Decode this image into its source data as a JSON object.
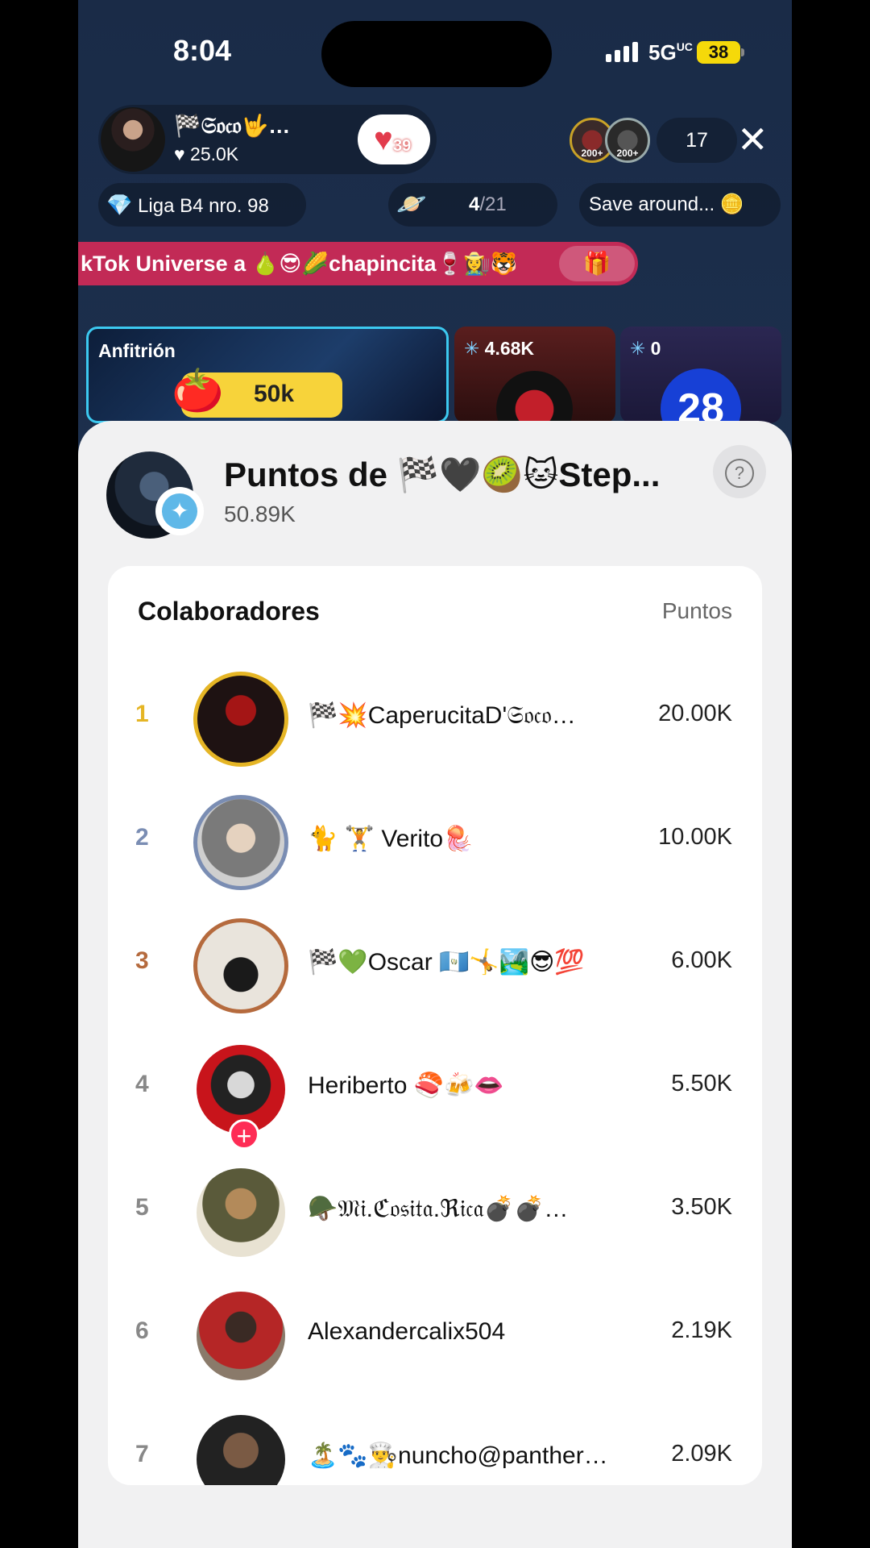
{
  "status": {
    "time": "8:04",
    "network": "5G",
    "battery": "38"
  },
  "host": {
    "name": "🏁𝔖𝔬𝔠𝔬🤟…",
    "likes": "25.0K",
    "badge_count": "39"
  },
  "viewers": {
    "badges": [
      "200+",
      "200+"
    ],
    "count": "17"
  },
  "chips": {
    "league": "Liga B4 nro. 98",
    "progress_current": "4",
    "progress_total": "/21",
    "save": "Save around..."
  },
  "marquee": {
    "text": "kTok Universe a 🍐😎🌽chapincita🍷👩‍🌾🐯"
  },
  "tiles": {
    "host_label": "Anfitrión",
    "host_goal": "50k",
    "guest1_points": "4.68K",
    "guest2_points": "0",
    "guest2_number": "28"
  },
  "sheet": {
    "title": "Puntos de 🏁🖤🥝🐱Step...",
    "subtitle": "50.89K",
    "list_header": "Colaboradores",
    "points_header": "Puntos",
    "rows": [
      {
        "rank": "1",
        "name": "🏁💥CaperucitaD'𝔖𝔬𝔠𝔬…",
        "points": "20.00K"
      },
      {
        "rank": "2",
        "name": "🐈 🏋️ Verito🪼",
        "points": "10.00K"
      },
      {
        "rank": "3",
        "name": "🏁💚Oscar 🇬🇹🤸🏞️😎💯",
        "points": "6.00K"
      },
      {
        "rank": "4",
        "name": "Heriberto 🍣🍻👄",
        "points": "5.50K"
      },
      {
        "rank": "5",
        "name": "🪖𝔐𝔦.ℭ𝔬𝔰𝔦𝔱𝔞.ℜ𝔦𝔠𝔞💣💣…",
        "points": "3.50K"
      },
      {
        "rank": "6",
        "name": "Alexandercalix504",
        "points": "2.19K"
      },
      {
        "rank": "7",
        "name": "🏝️🐾👨‍🍳nuncho@panther…",
        "points": "2.09K"
      }
    ]
  },
  "colors": {
    "gold": "#e5b525",
    "silver": "#7a8db3",
    "bronze": "#b56a3d",
    "rest": "#888888",
    "accent": "#fe2c55"
  }
}
